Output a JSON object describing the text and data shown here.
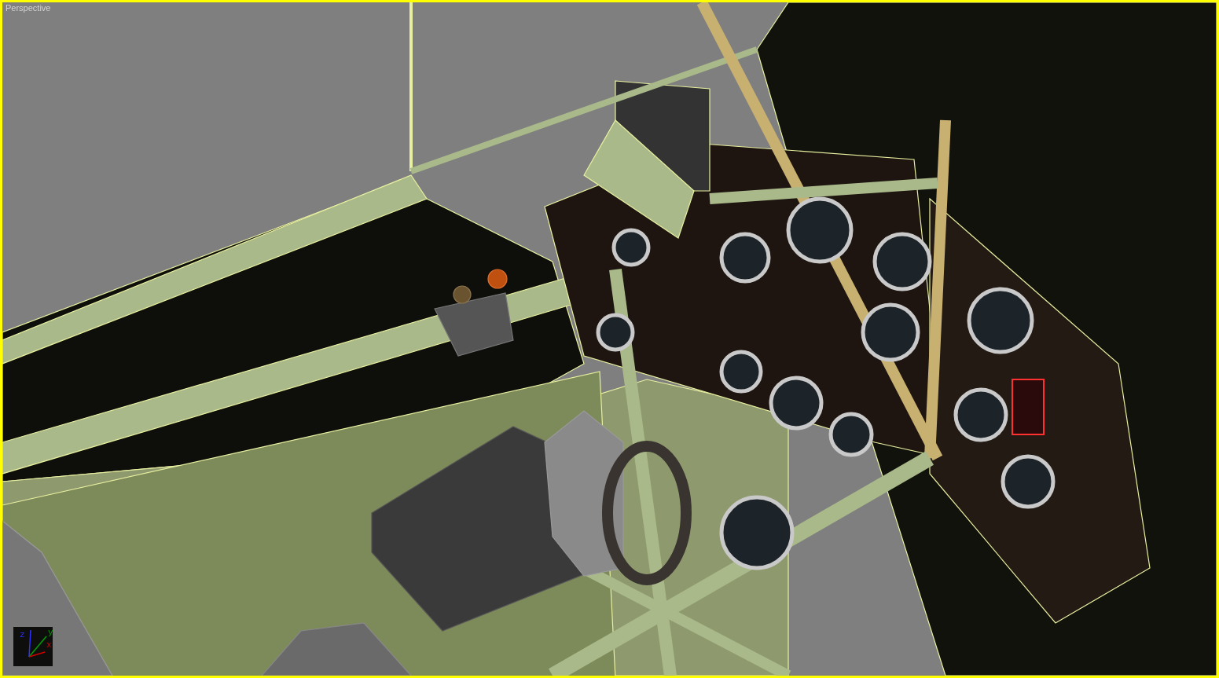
{
  "viewport": {
    "label": "Perspective",
    "active": true,
    "axes": [
      {
        "kind": "z",
        "label": "z"
      },
      {
        "kind": "y",
        "label": "y"
      },
      {
        "kind": "x",
        "label": "x"
      }
    ]
  }
}
